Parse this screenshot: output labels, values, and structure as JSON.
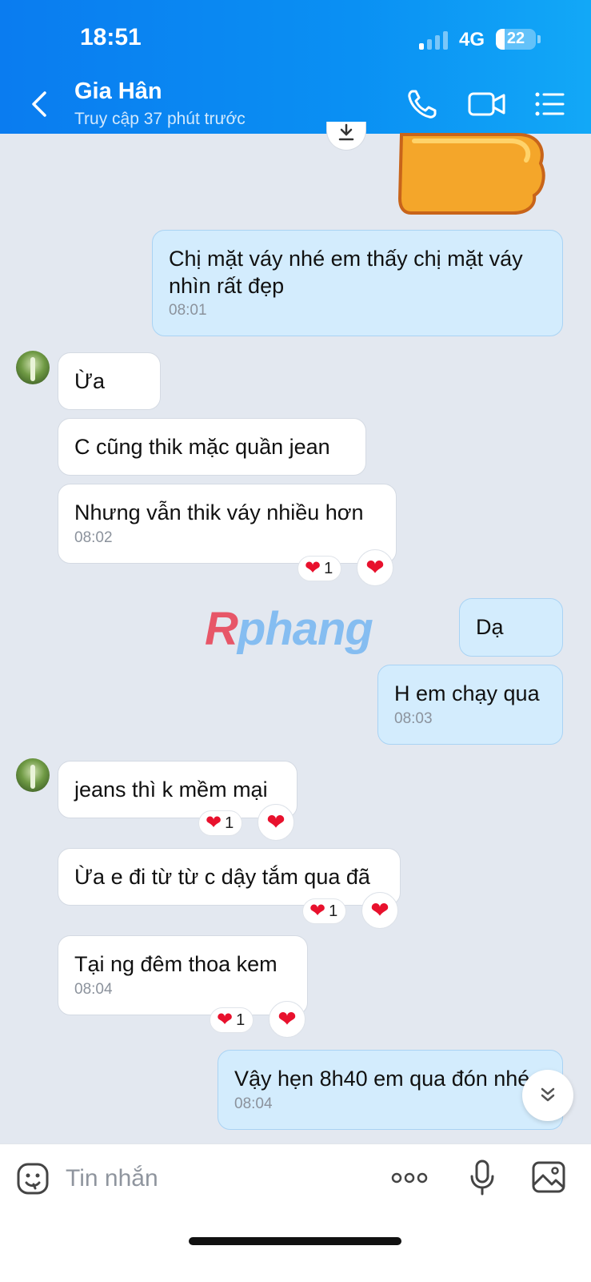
{
  "status_bar": {
    "time": "18:51",
    "network": "4G",
    "battery": "22"
  },
  "header": {
    "contact_name": "Gia Hân",
    "last_seen": "Truy cập 37 phút trước"
  },
  "messages": [
    {
      "sender": "me",
      "text": "Chị mặt váy nhé em thấy chị mặt váy nhìn rất đẹp",
      "time": "08:01"
    },
    {
      "sender": "them",
      "text": "Ừa"
    },
    {
      "sender": "them",
      "text": "C cũng thik mặc quần jean"
    },
    {
      "sender": "them",
      "text": "Nhưng vẫn thik váy nhiều hơn",
      "time": "08:02",
      "reaction_count": "1"
    },
    {
      "sender": "me",
      "text": "Dạ"
    },
    {
      "sender": "me",
      "text": "H em chạy qua",
      "time": "08:03"
    },
    {
      "sender": "them",
      "text": "jeans thì k mềm mại",
      "reaction_count": "1"
    },
    {
      "sender": "them",
      "text": "Ừa e đi từ từ c dậy tắm qua đã",
      "reaction_count": "1"
    },
    {
      "sender": "them",
      "text": "Tại ng đêm thoa kem",
      "time": "08:04",
      "reaction_count": "1"
    },
    {
      "sender": "me",
      "text": "Vậy hẹn 8h40 em qua đón nhé",
      "time": "08:04"
    }
  ],
  "watermark": "Rphang",
  "composer": {
    "placeholder": "Tin nhắn"
  },
  "colors": {
    "header": "#0a86f2",
    "my_bubble": "#d3ecfd",
    "their_bubble": "#ffffff",
    "reaction": "#e8112d"
  }
}
